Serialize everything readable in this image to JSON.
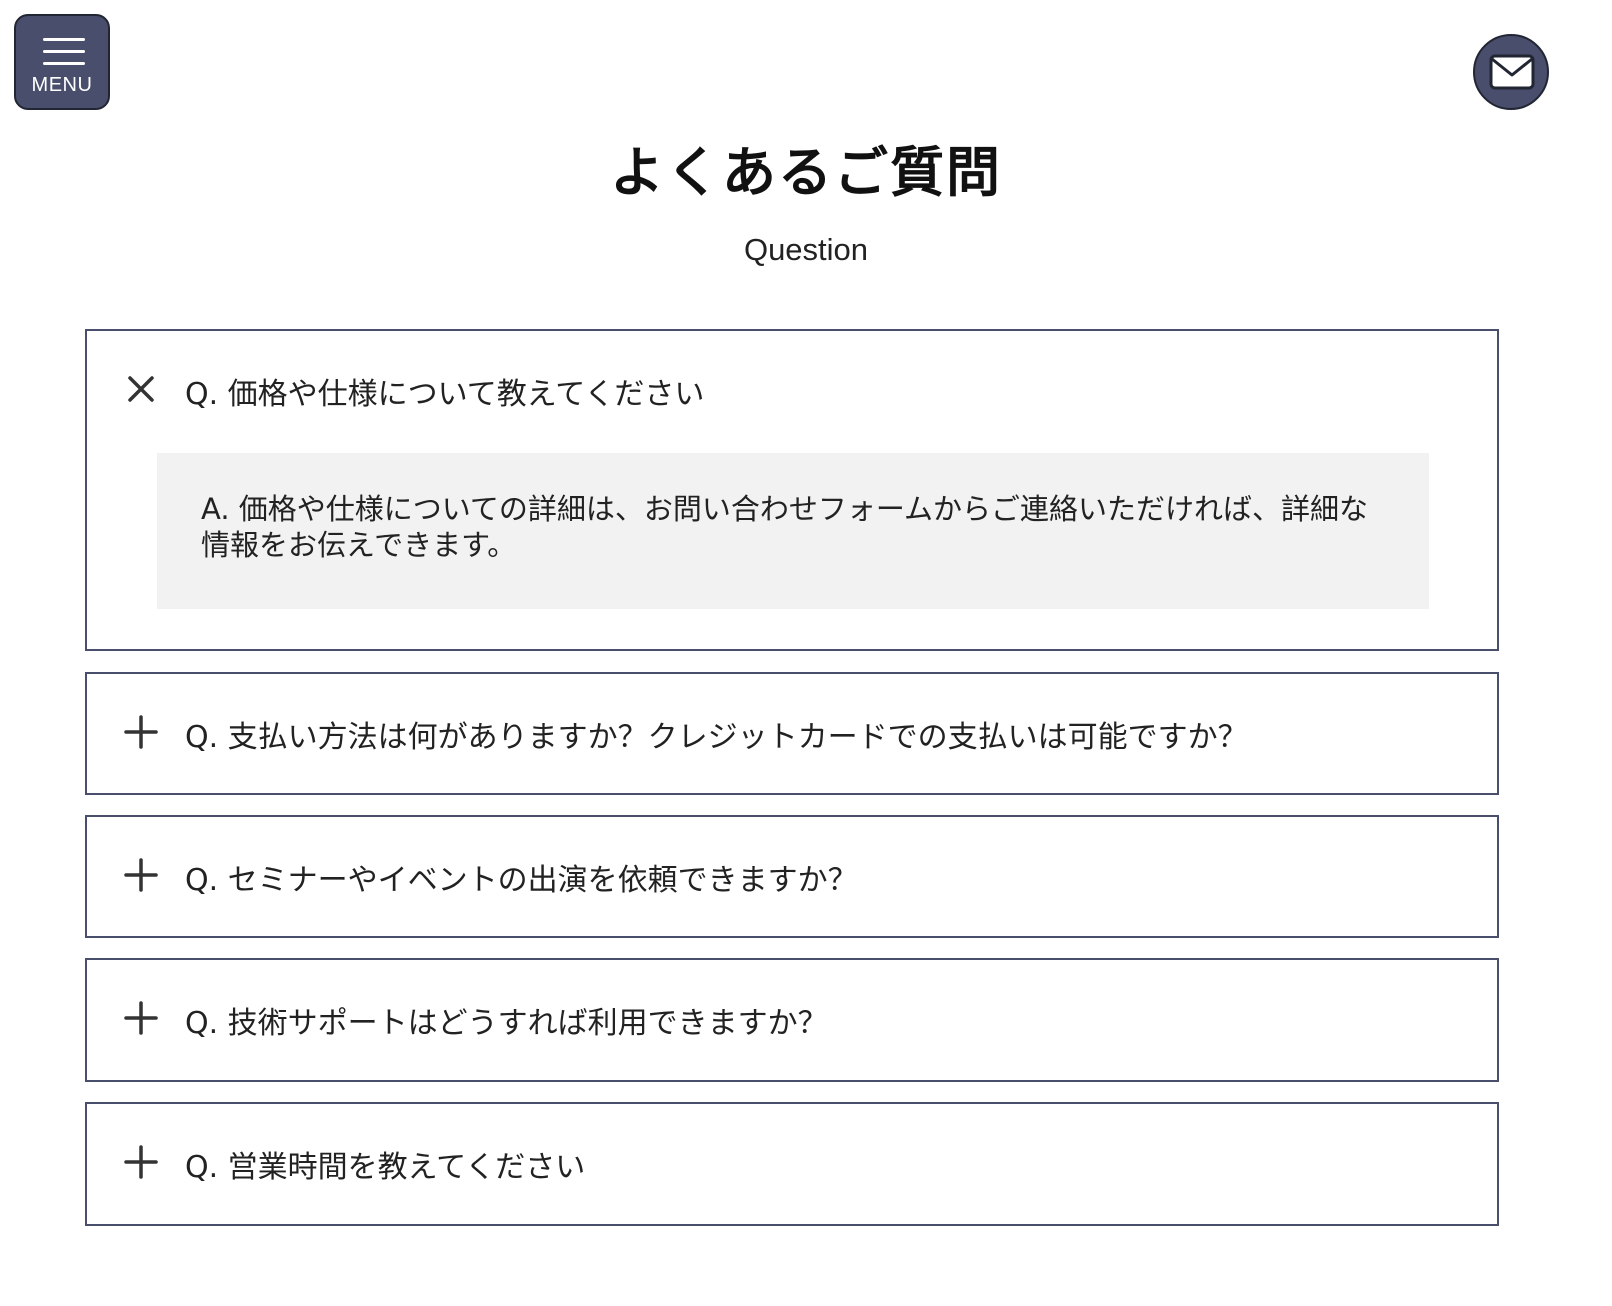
{
  "header": {
    "menu_label": "MENU",
    "menu_icon": "hamburger-icon",
    "contact_icon": "mail-icon"
  },
  "section": {
    "title": "よくあるご質問",
    "subtitle": "Question"
  },
  "faq": [
    {
      "question": "Q. 価格や仕様について教えてください",
      "expanded": true,
      "toggle_icon": "close-icon",
      "answer": "A. 価格や仕様についての詳細は、お問い合わせフォームからご連絡いただければ、詳細な情報をお伝えできます。"
    },
    {
      "question": "Q. 支払い方法は何がありますか？クレジットカードでの支払いは可能ですか？",
      "expanded": false,
      "toggle_icon": "plus-icon"
    },
    {
      "question": "Q. セミナーやイベントの出演を依頼できますか？",
      "expanded": false,
      "toggle_icon": "plus-icon"
    },
    {
      "question": "Q. 技術サポートはどうすれば利用できますか？",
      "expanded": false,
      "toggle_icon": "plus-icon"
    },
    {
      "question": "Q. 営業時間を教えてください",
      "expanded": false,
      "toggle_icon": "plus-icon"
    }
  ],
  "colors": {
    "accent": "#484e6c",
    "answer_background": "#f2f2f2"
  }
}
